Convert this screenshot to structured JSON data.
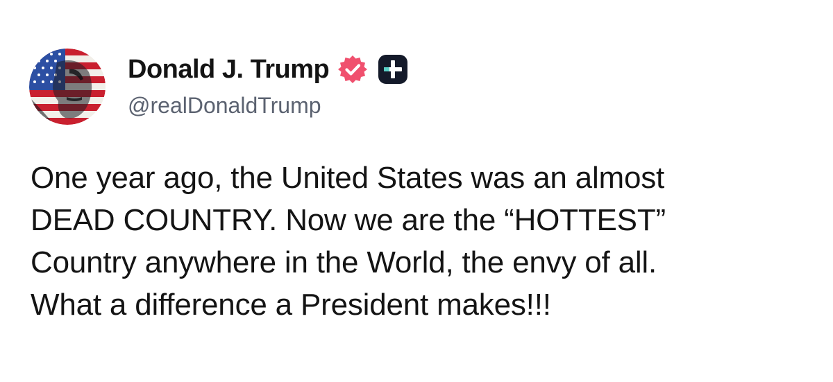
{
  "post": {
    "author": {
      "display_name": "Donald J. Trump",
      "handle": "@realDonaldTrump",
      "avatar_icon": "flag-portrait-avatar",
      "verified_icon": "verified-check-icon",
      "verified_color": "#f0506e",
      "plus_badge_icon": "plus-badge-icon",
      "plus_badge_color": "#141a2a",
      "plus_badge_accent": "#5ad1c8"
    },
    "body_lines": [
      "One year ago, the United States was an almost",
      "DEAD COUNTRY. Now we are the “HOTTEST”",
      "Country anywhere in the World, the envy of all.",
      "What a difference a President makes!!!"
    ]
  },
  "colors": {
    "background": "#ffffff",
    "text": "#141414",
    "handle": "#5b6270"
  }
}
